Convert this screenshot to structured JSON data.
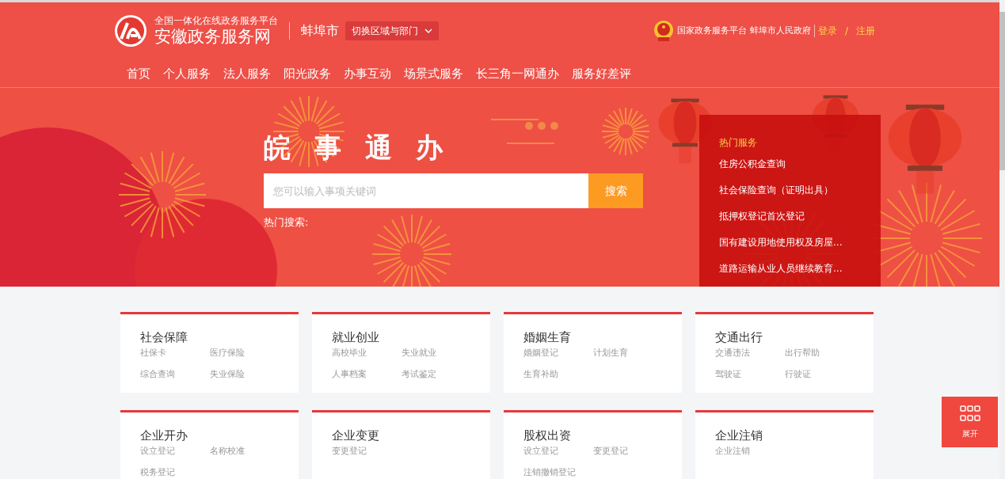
{
  "header": {
    "platform_tagline": "全国一体化在线政务服务平台",
    "site_name": "安徽政务服务网",
    "city": "蚌埠市",
    "region_switch": "切换区域与部门",
    "national_link": "国家政务服务平台",
    "city_gov_link": "蚌埠市人民政府",
    "login": "登录",
    "separator": "/",
    "register": "注册"
  },
  "nav": [
    {
      "label": "首页"
    },
    {
      "label": "个人服务"
    },
    {
      "label": "法人服务"
    },
    {
      "label": "阳光政务"
    },
    {
      "label": "办事互动"
    },
    {
      "label": "场景式服务"
    },
    {
      "label": "长三角一网通办"
    },
    {
      "label": "服务好差评"
    }
  ],
  "hero": {
    "title": [
      "皖",
      "事",
      "通",
      "办"
    ],
    "search": {
      "placeholder": "您可以输入事项关键词",
      "button": "搜索"
    },
    "hot_search_label": "热门搜索:"
  },
  "hot_services": {
    "title": "热门服务",
    "items": [
      "住房公积金查询",
      "社会保险查询（证明出具）",
      "抵押权登记首次登记",
      "国有建设用地使用权及房屋...",
      "道路运输从业人员继续教育..."
    ]
  },
  "categories": [
    {
      "title": "社会保障",
      "links": [
        "社保卡",
        "医疗保险",
        "综合查询",
        "失业保险"
      ]
    },
    {
      "title": "就业创业",
      "links": [
        "高校毕业",
        "失业就业",
        "人事档案",
        "考试鉴定"
      ]
    },
    {
      "title": "婚姻生育",
      "links": [
        "婚姻登记",
        "计划生育",
        "生育补助"
      ]
    },
    {
      "title": "交通出行",
      "links": [
        "交通违法",
        "出行帮助",
        "驾驶证",
        "行驶证"
      ]
    },
    {
      "title": "企业开办",
      "links": [
        "设立登记",
        "名称校准",
        "税务登记"
      ]
    },
    {
      "title": "企业变更",
      "links": [
        "变更登记"
      ]
    },
    {
      "title": "股权出资",
      "links": [
        "设立登记",
        "变更登记",
        "注销撤销登记"
      ]
    },
    {
      "title": "企业注销",
      "links": [
        "企业注销"
      ]
    }
  ],
  "float_button": {
    "label": "展开"
  }
}
